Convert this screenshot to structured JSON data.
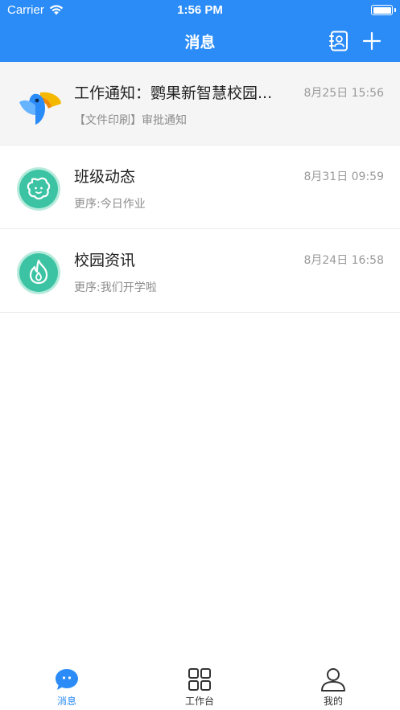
{
  "status_bar": {
    "carrier": "Carrier",
    "time": "1:56 PM"
  },
  "header": {
    "title": "消息"
  },
  "messages": [
    {
      "title": "工作通知：鹦果新智慧校园...",
      "time": "8月25日 15:56",
      "subtitle": "【文件印刷】审批通知",
      "icon": "parrot-logo-icon"
    },
    {
      "title": "班级动态",
      "time": "8月31日 09:59",
      "subtitle": "更序:今日作业",
      "icon": "class-dynamic-icon"
    },
    {
      "title": "校园资讯",
      "time": "8月24日 16:58",
      "subtitle": "更序:我们开学啦",
      "icon": "flame-icon"
    }
  ],
  "tabbar": {
    "tabs": [
      {
        "label": "消息",
        "icon": "chat-bubble-icon"
      },
      {
        "label": "工作台",
        "icon": "grid-icon"
      },
      {
        "label": "我的",
        "icon": "person-icon"
      }
    ]
  },
  "colors": {
    "brand": "#2b8cf7",
    "teal_avatar": "#3cc3a3",
    "border_ring": "#b6ebdc"
  }
}
